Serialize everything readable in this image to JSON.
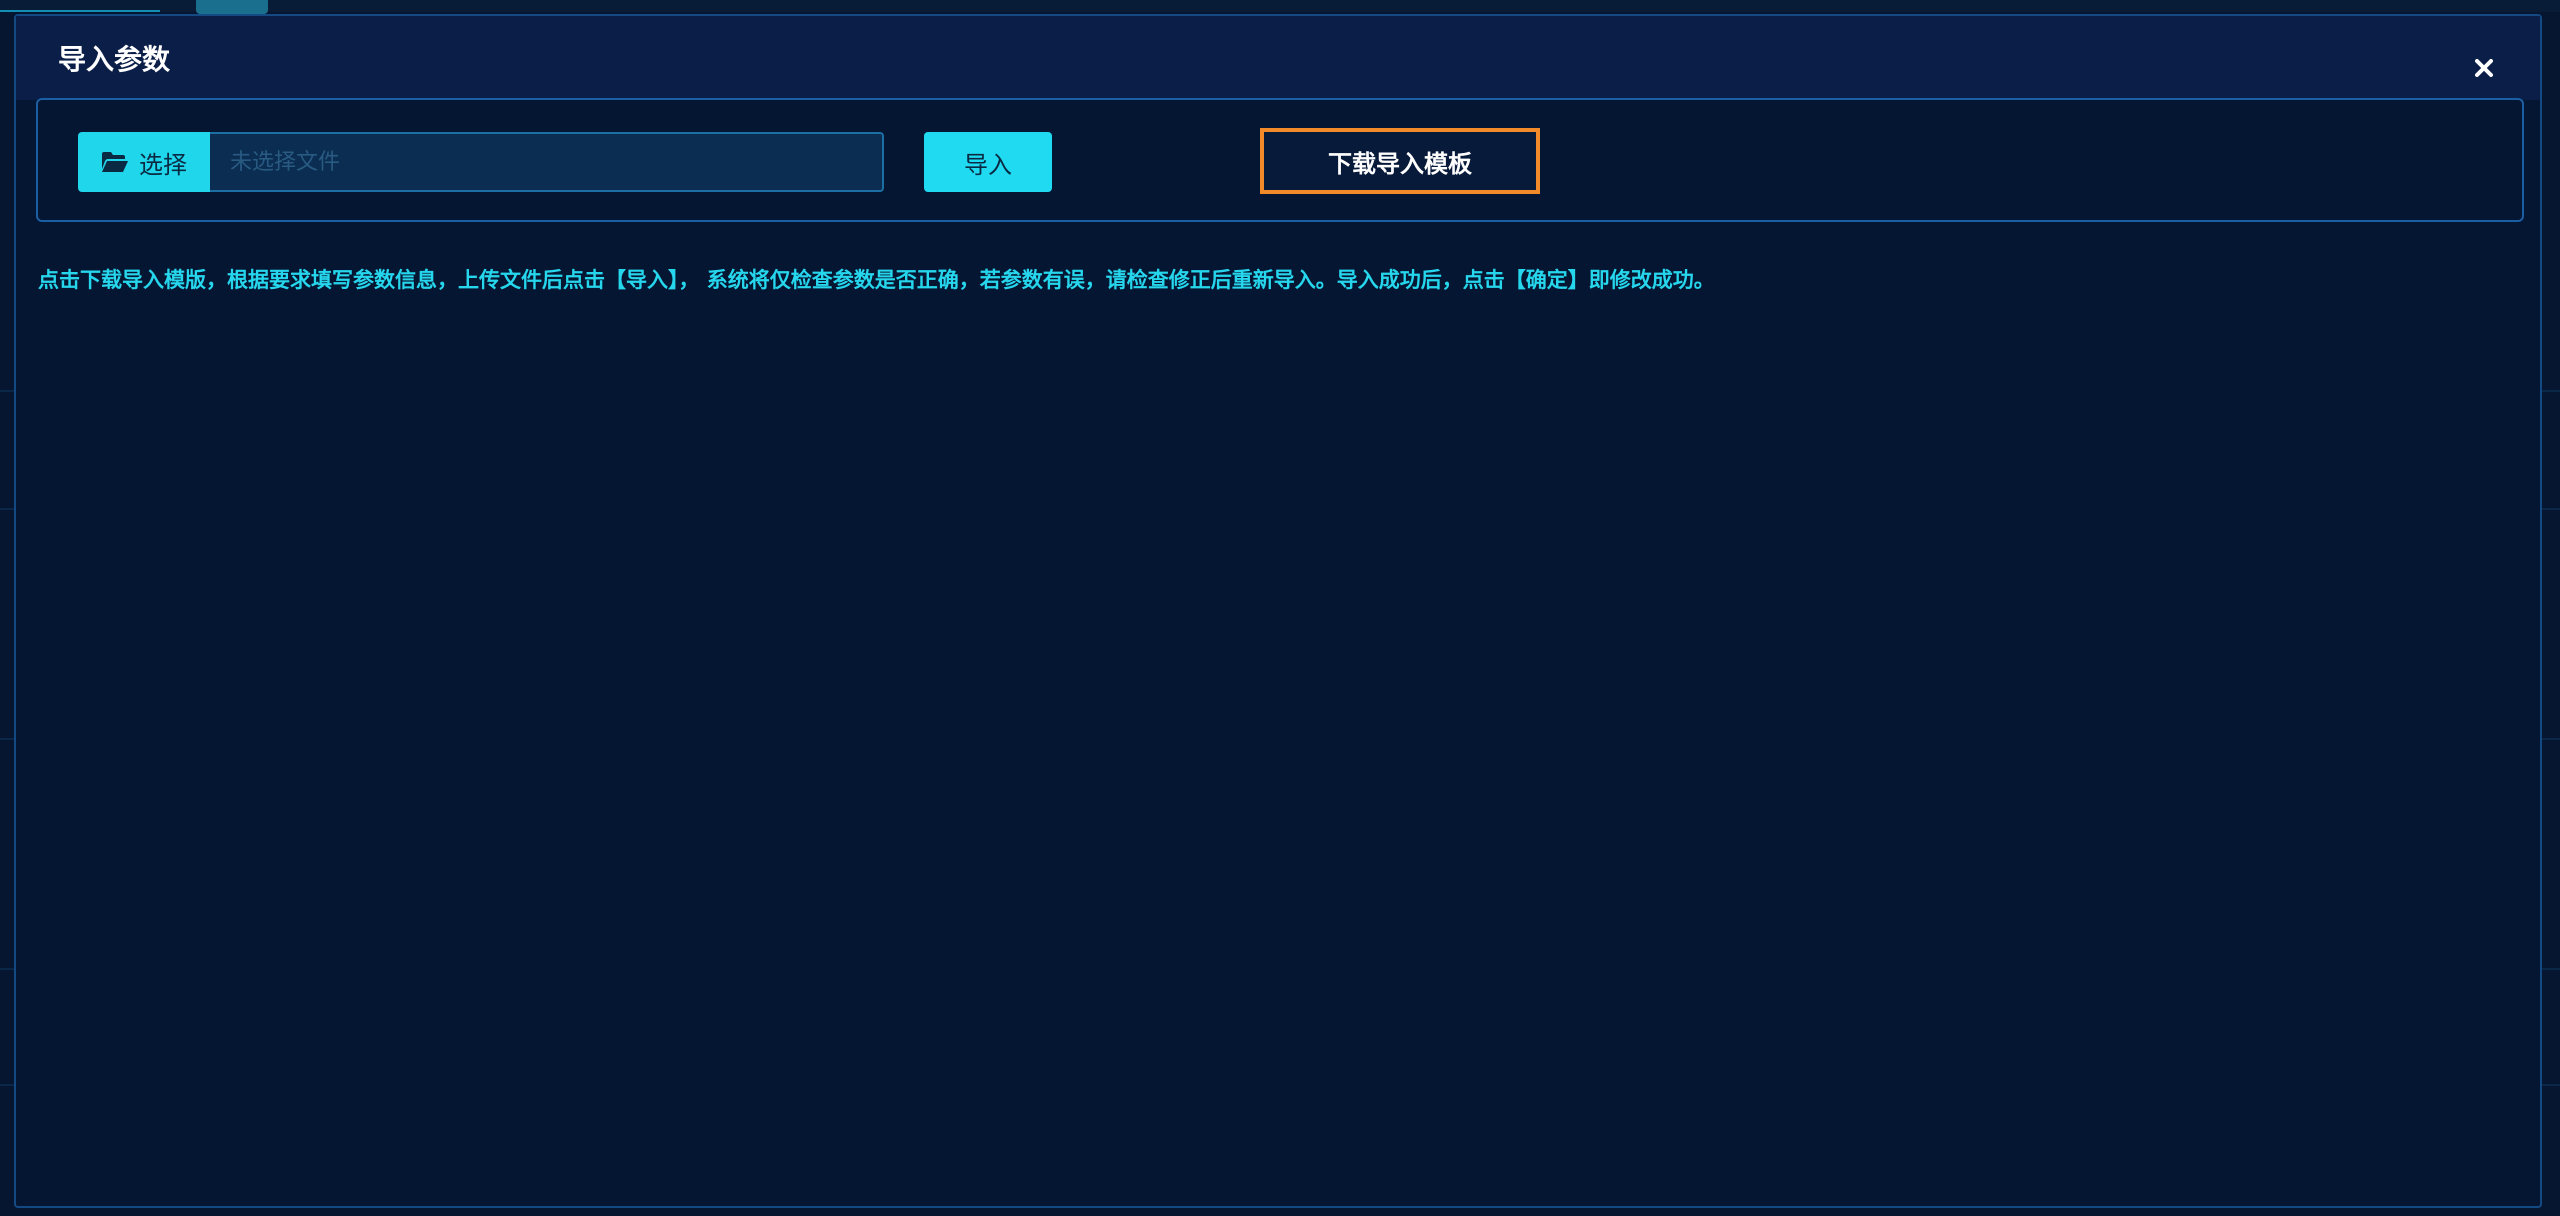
{
  "modal": {
    "title": "导入参数",
    "close_label": "×"
  },
  "upload": {
    "choose_label": "选择",
    "file_placeholder": "未选择文件",
    "import_label": "导入",
    "download_template_label": "下载导入模板"
  },
  "instruction": "点击下载导入模版，根据要求填写参数信息，上传文件后点击【导入】， 系统将仅检查参数是否正确，若参数有误，请检查修正后重新导入。导入成功后，点击【确定】即修改成功。",
  "colors": {
    "accent": "#1fd6ea",
    "highlight_border": "#f28a2a",
    "background": "#051633",
    "panel_border": "#1a5fa3",
    "instruction_text": "#26d6ec"
  },
  "icons": {
    "choose": "folder-open-icon",
    "close": "close-icon"
  }
}
